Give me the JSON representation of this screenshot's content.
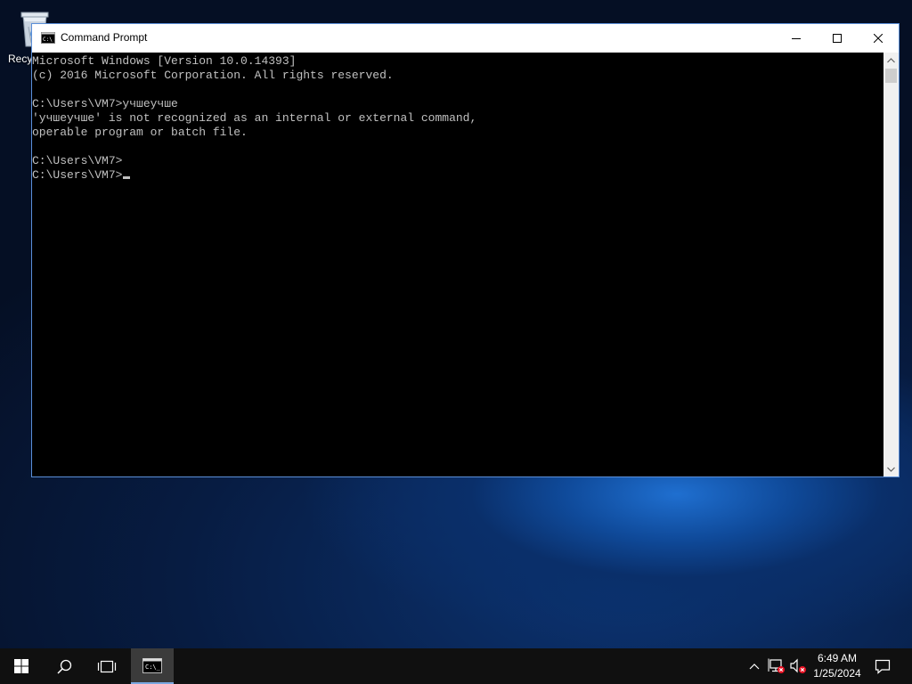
{
  "desktop": {
    "icons": [
      {
        "name": "recycle-bin",
        "label": "Recycle Bin",
        "visible_label": "Recy"
      }
    ]
  },
  "window": {
    "title": "Command Prompt",
    "buttons": {
      "minimize": "minimize",
      "maximize": "maximize",
      "close": "close"
    }
  },
  "console": {
    "lines": [
      "Microsoft Windows [Version 10.0.14393]",
      "(c) 2016 Microsoft Corporation. All rights reserved.",
      "",
      "C:\\Users\\VM7>учшеучше",
      "'учшеучше' is not recognized as an internal or external command,",
      "operable program or batch file.",
      "",
      "C:\\Users\\VM7>",
      "C:\\Users\\VM7>"
    ]
  },
  "taskbar": {
    "pinned": [
      {
        "name": "start",
        "icon": "windows-logo-icon"
      },
      {
        "name": "search",
        "icon": "search-icon"
      },
      {
        "name": "task-view",
        "icon": "task-view-icon"
      },
      {
        "name": "command-prompt",
        "icon": "cmd-icon",
        "active": true
      }
    ],
    "tray": {
      "icons": [
        "chevron-up-icon",
        "network-error-icon",
        "volume-muted-icon"
      ],
      "time": "6:49 AM",
      "date": "1/25/2024",
      "notification_icon": "action-center-icon"
    }
  },
  "colors": {
    "console_bg": "#000000",
    "console_text": "#c0c0c0",
    "taskbar_bg": "#101010",
    "active_task_underline": "#7aa7e0",
    "window_border": "#5b8fd8"
  }
}
